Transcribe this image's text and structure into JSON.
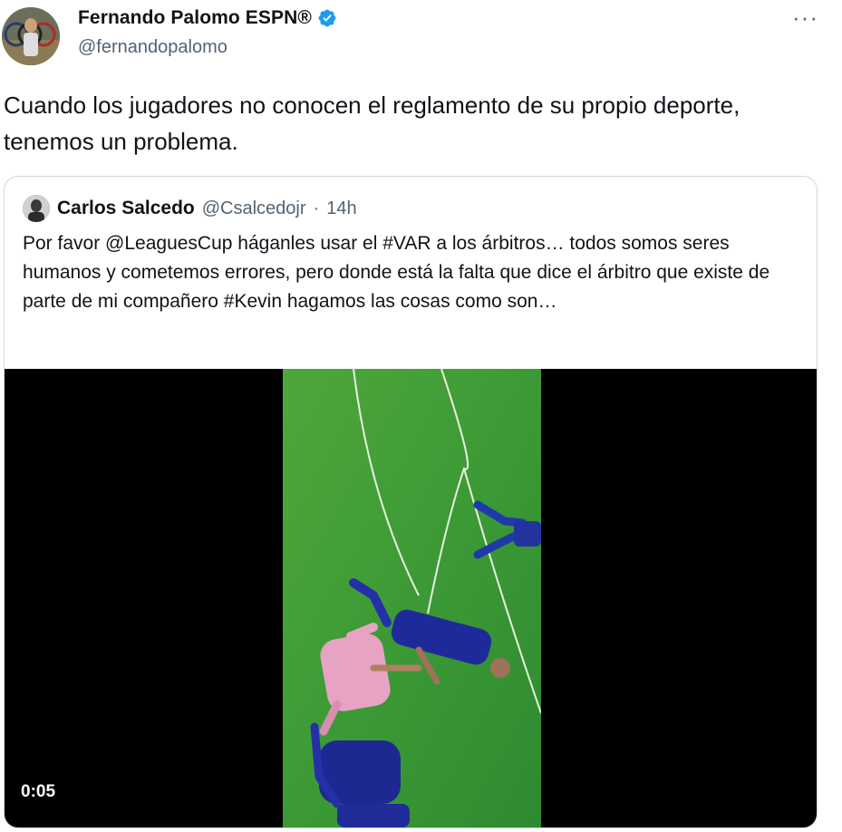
{
  "author": {
    "display_name": "Fernando Palomo ESPN®",
    "handle": "@fernandopalomo",
    "verified_icon": "verified-badge-icon",
    "accent": "#1d9bf0"
  },
  "more_label": "···",
  "tweet": {
    "text": "Cuando los jugadores no conocen el reglamento de su propio deporte, tenemos un problema."
  },
  "quoted": {
    "display_name": "Carlos Salcedo",
    "handle": "@Csalcedojr",
    "separator": "·",
    "time": "14h",
    "text": "Por favor @LeaguesCup háganles usar el #VAR a los árbitros… todos somos seres humanos y cometemos errores, pero donde está la falta que dice el árbitro que existe de parte de mi compañero #Kevin hagamos las cosas como son…",
    "media": {
      "duration": "0:05"
    }
  }
}
